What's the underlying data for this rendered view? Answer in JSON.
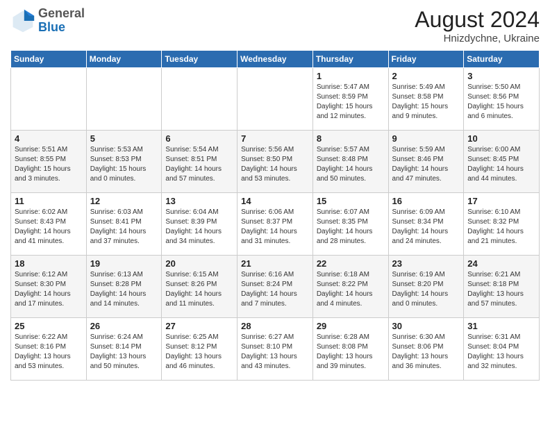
{
  "header": {
    "logo_general": "General",
    "logo_blue": "Blue",
    "month_year": "August 2024",
    "location": "Hnizdychne, Ukraine"
  },
  "days_of_week": [
    "Sunday",
    "Monday",
    "Tuesday",
    "Wednesday",
    "Thursday",
    "Friday",
    "Saturday"
  ],
  "weeks": [
    [
      {
        "day": "",
        "info": ""
      },
      {
        "day": "",
        "info": ""
      },
      {
        "day": "",
        "info": ""
      },
      {
        "day": "",
        "info": ""
      },
      {
        "day": "1",
        "info": "Sunrise: 5:47 AM\nSunset: 8:59 PM\nDaylight: 15 hours\nand 12 minutes."
      },
      {
        "day": "2",
        "info": "Sunrise: 5:49 AM\nSunset: 8:58 PM\nDaylight: 15 hours\nand 9 minutes."
      },
      {
        "day": "3",
        "info": "Sunrise: 5:50 AM\nSunset: 8:56 PM\nDaylight: 15 hours\nand 6 minutes."
      }
    ],
    [
      {
        "day": "4",
        "info": "Sunrise: 5:51 AM\nSunset: 8:55 PM\nDaylight: 15 hours\nand 3 minutes."
      },
      {
        "day": "5",
        "info": "Sunrise: 5:53 AM\nSunset: 8:53 PM\nDaylight: 15 hours\nand 0 minutes."
      },
      {
        "day": "6",
        "info": "Sunrise: 5:54 AM\nSunset: 8:51 PM\nDaylight: 14 hours\nand 57 minutes."
      },
      {
        "day": "7",
        "info": "Sunrise: 5:56 AM\nSunset: 8:50 PM\nDaylight: 14 hours\nand 53 minutes."
      },
      {
        "day": "8",
        "info": "Sunrise: 5:57 AM\nSunset: 8:48 PM\nDaylight: 14 hours\nand 50 minutes."
      },
      {
        "day": "9",
        "info": "Sunrise: 5:59 AM\nSunset: 8:46 PM\nDaylight: 14 hours\nand 47 minutes."
      },
      {
        "day": "10",
        "info": "Sunrise: 6:00 AM\nSunset: 8:45 PM\nDaylight: 14 hours\nand 44 minutes."
      }
    ],
    [
      {
        "day": "11",
        "info": "Sunrise: 6:02 AM\nSunset: 8:43 PM\nDaylight: 14 hours\nand 41 minutes."
      },
      {
        "day": "12",
        "info": "Sunrise: 6:03 AM\nSunset: 8:41 PM\nDaylight: 14 hours\nand 37 minutes."
      },
      {
        "day": "13",
        "info": "Sunrise: 6:04 AM\nSunset: 8:39 PM\nDaylight: 14 hours\nand 34 minutes."
      },
      {
        "day": "14",
        "info": "Sunrise: 6:06 AM\nSunset: 8:37 PM\nDaylight: 14 hours\nand 31 minutes."
      },
      {
        "day": "15",
        "info": "Sunrise: 6:07 AM\nSunset: 8:35 PM\nDaylight: 14 hours\nand 28 minutes."
      },
      {
        "day": "16",
        "info": "Sunrise: 6:09 AM\nSunset: 8:34 PM\nDaylight: 14 hours\nand 24 minutes."
      },
      {
        "day": "17",
        "info": "Sunrise: 6:10 AM\nSunset: 8:32 PM\nDaylight: 14 hours\nand 21 minutes."
      }
    ],
    [
      {
        "day": "18",
        "info": "Sunrise: 6:12 AM\nSunset: 8:30 PM\nDaylight: 14 hours\nand 17 minutes."
      },
      {
        "day": "19",
        "info": "Sunrise: 6:13 AM\nSunset: 8:28 PM\nDaylight: 14 hours\nand 14 minutes."
      },
      {
        "day": "20",
        "info": "Sunrise: 6:15 AM\nSunset: 8:26 PM\nDaylight: 14 hours\nand 11 minutes."
      },
      {
        "day": "21",
        "info": "Sunrise: 6:16 AM\nSunset: 8:24 PM\nDaylight: 14 hours\nand 7 minutes."
      },
      {
        "day": "22",
        "info": "Sunrise: 6:18 AM\nSunset: 8:22 PM\nDaylight: 14 hours\nand 4 minutes."
      },
      {
        "day": "23",
        "info": "Sunrise: 6:19 AM\nSunset: 8:20 PM\nDaylight: 14 hours\nand 0 minutes."
      },
      {
        "day": "24",
        "info": "Sunrise: 6:21 AM\nSunset: 8:18 PM\nDaylight: 13 hours\nand 57 minutes."
      }
    ],
    [
      {
        "day": "25",
        "info": "Sunrise: 6:22 AM\nSunset: 8:16 PM\nDaylight: 13 hours\nand 53 minutes."
      },
      {
        "day": "26",
        "info": "Sunrise: 6:24 AM\nSunset: 8:14 PM\nDaylight: 13 hours\nand 50 minutes."
      },
      {
        "day": "27",
        "info": "Sunrise: 6:25 AM\nSunset: 8:12 PM\nDaylight: 13 hours\nand 46 minutes."
      },
      {
        "day": "28",
        "info": "Sunrise: 6:27 AM\nSunset: 8:10 PM\nDaylight: 13 hours\nand 43 minutes."
      },
      {
        "day": "29",
        "info": "Sunrise: 6:28 AM\nSunset: 8:08 PM\nDaylight: 13 hours\nand 39 minutes."
      },
      {
        "day": "30",
        "info": "Sunrise: 6:30 AM\nSunset: 8:06 PM\nDaylight: 13 hours\nand 36 minutes."
      },
      {
        "day": "31",
        "info": "Sunrise: 6:31 AM\nSunset: 8:04 PM\nDaylight: 13 hours\nand 32 minutes."
      }
    ]
  ]
}
